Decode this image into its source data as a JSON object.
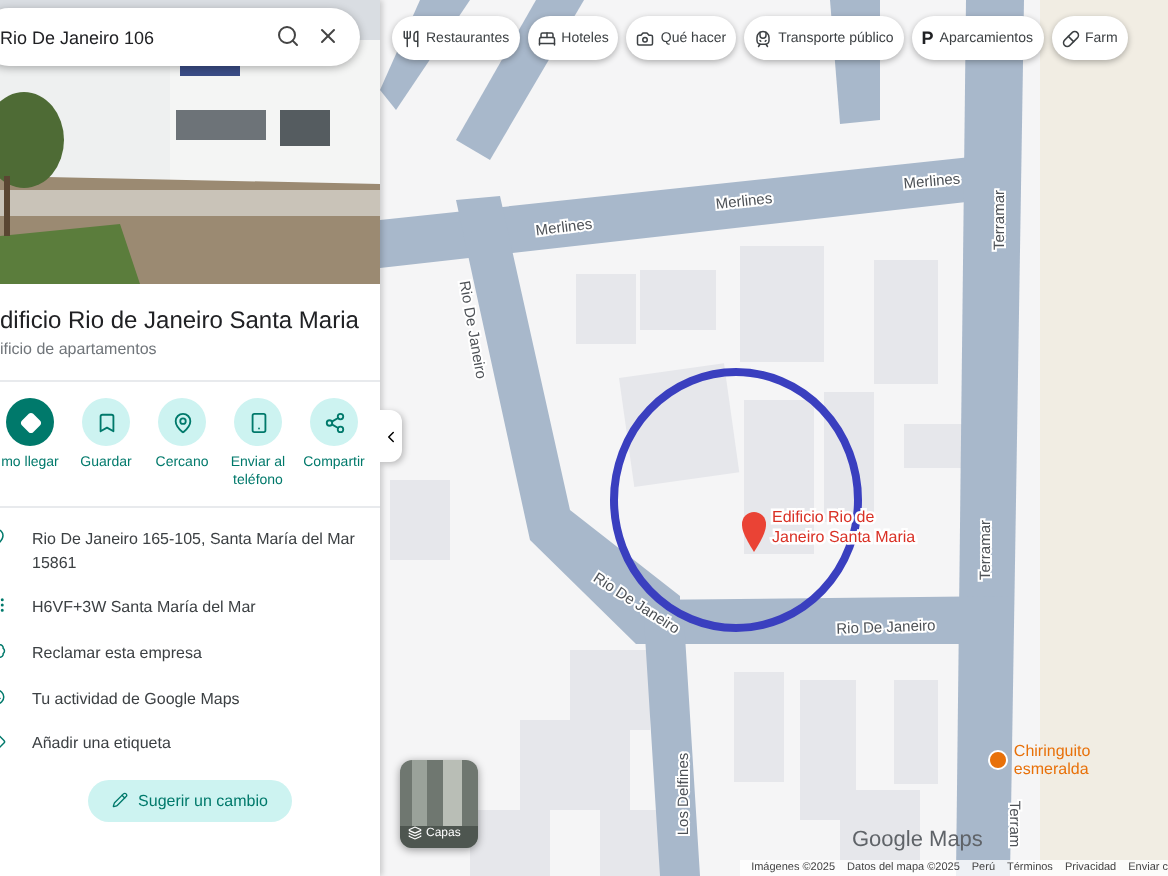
{
  "search": {
    "value": "Rio De Janeiro 106"
  },
  "place": {
    "title": "dificio Rio de Janeiro Santa Maria",
    "subtitle": "ificio de apartamentos"
  },
  "actions": [
    {
      "label": "mo llegar",
      "kind": "directions",
      "primary": true
    },
    {
      "label": "Guardar",
      "kind": "save",
      "primary": false
    },
    {
      "label": "Cercano",
      "kind": "nearby",
      "primary": false
    },
    {
      "label": "Enviar al teléfono",
      "kind": "phone",
      "primary": false
    },
    {
      "label": "Compartir",
      "kind": "share",
      "primary": false
    }
  ],
  "details": [
    {
      "text": "Rio De Janeiro 165-105, Santa María del Mar 15861",
      "kind": "address"
    },
    {
      "text": "H6VF+3W Santa María del Mar",
      "kind": "pluscode"
    },
    {
      "text": "Reclamar esta empresa",
      "kind": "claim"
    },
    {
      "text": "Tu actividad de Google Maps",
      "kind": "activity"
    },
    {
      "text": "Añadir una etiqueta",
      "kind": "label"
    }
  ],
  "suggest_button": "Sugerir un cambio",
  "chips": [
    {
      "label": "Restaurantes",
      "kind": "restaurant"
    },
    {
      "label": "Hoteles",
      "kind": "hotel"
    },
    {
      "label": "Qué hacer",
      "kind": "things"
    },
    {
      "label": "Transporte público",
      "kind": "transit"
    },
    {
      "label": "Aparcamientos",
      "kind": "parking",
      "glyph": "P"
    },
    {
      "label": "Farm",
      "kind": "pharmacy"
    }
  ],
  "map": {
    "road_labels": [
      "Merlines",
      "Merlines",
      "Merlines",
      "Terramar",
      "Terramar",
      "Terram",
      "Rio De Janeiro",
      "Rio De Janeiro",
      "Rio De Janeiro",
      "Los Delfines"
    ],
    "place_marker": {
      "lines": [
        "Edificio Rio de",
        "Janeiro Santa Maria"
      ]
    },
    "poi": {
      "label": "Chiringuito esmeralda"
    },
    "layers_button": "Capas",
    "logo": "Google Maps",
    "footer": [
      "Imágenes ©2025",
      "Datos del mapa ©2025",
      "Perú",
      "Términos",
      "Privacidad",
      "Enviar c"
    ]
  }
}
